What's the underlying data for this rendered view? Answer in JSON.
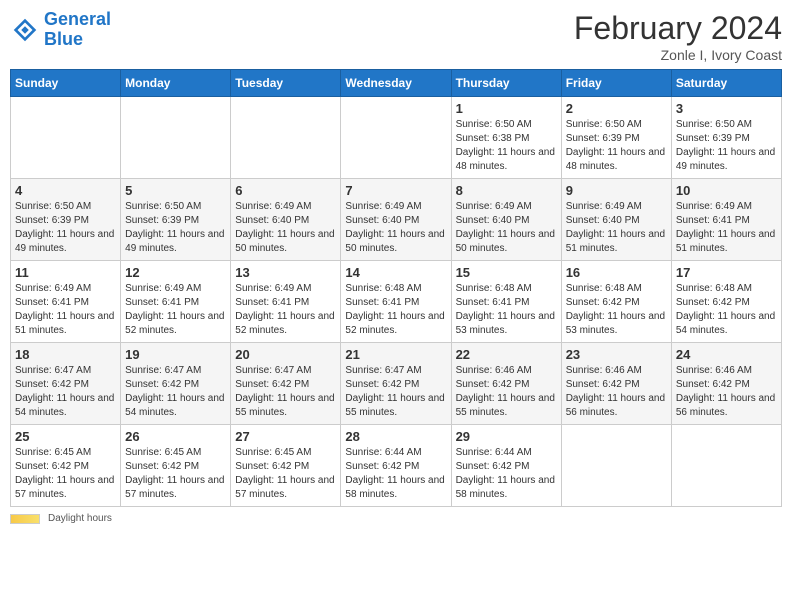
{
  "header": {
    "logo_general": "General",
    "logo_blue": "Blue",
    "month_year": "February 2024",
    "location": "Zonle I, Ivory Coast"
  },
  "days_of_week": [
    "Sunday",
    "Monday",
    "Tuesday",
    "Wednesday",
    "Thursday",
    "Friday",
    "Saturday"
  ],
  "footer": {
    "daylight_label": "Daylight hours"
  },
  "weeks": [
    [
      {
        "day": "",
        "info": ""
      },
      {
        "day": "",
        "info": ""
      },
      {
        "day": "",
        "info": ""
      },
      {
        "day": "",
        "info": ""
      },
      {
        "day": "1",
        "info": "Sunrise: 6:50 AM\nSunset: 6:38 PM\nDaylight: 11 hours\nand 48 minutes."
      },
      {
        "day": "2",
        "info": "Sunrise: 6:50 AM\nSunset: 6:39 PM\nDaylight: 11 hours\nand 48 minutes."
      },
      {
        "day": "3",
        "info": "Sunrise: 6:50 AM\nSunset: 6:39 PM\nDaylight: 11 hours\nand 49 minutes."
      }
    ],
    [
      {
        "day": "4",
        "info": "Sunrise: 6:50 AM\nSunset: 6:39 PM\nDaylight: 11 hours\nand 49 minutes."
      },
      {
        "day": "5",
        "info": "Sunrise: 6:50 AM\nSunset: 6:39 PM\nDaylight: 11 hours\nand 49 minutes."
      },
      {
        "day": "6",
        "info": "Sunrise: 6:49 AM\nSunset: 6:40 PM\nDaylight: 11 hours\nand 50 minutes."
      },
      {
        "day": "7",
        "info": "Sunrise: 6:49 AM\nSunset: 6:40 PM\nDaylight: 11 hours\nand 50 minutes."
      },
      {
        "day": "8",
        "info": "Sunrise: 6:49 AM\nSunset: 6:40 PM\nDaylight: 11 hours\nand 50 minutes."
      },
      {
        "day": "9",
        "info": "Sunrise: 6:49 AM\nSunset: 6:40 PM\nDaylight: 11 hours\nand 51 minutes."
      },
      {
        "day": "10",
        "info": "Sunrise: 6:49 AM\nSunset: 6:41 PM\nDaylight: 11 hours\nand 51 minutes."
      }
    ],
    [
      {
        "day": "11",
        "info": "Sunrise: 6:49 AM\nSunset: 6:41 PM\nDaylight: 11 hours\nand 51 minutes."
      },
      {
        "day": "12",
        "info": "Sunrise: 6:49 AM\nSunset: 6:41 PM\nDaylight: 11 hours\nand 52 minutes."
      },
      {
        "day": "13",
        "info": "Sunrise: 6:49 AM\nSunset: 6:41 PM\nDaylight: 11 hours\nand 52 minutes."
      },
      {
        "day": "14",
        "info": "Sunrise: 6:48 AM\nSunset: 6:41 PM\nDaylight: 11 hours\nand 52 minutes."
      },
      {
        "day": "15",
        "info": "Sunrise: 6:48 AM\nSunset: 6:41 PM\nDaylight: 11 hours\nand 53 minutes."
      },
      {
        "day": "16",
        "info": "Sunrise: 6:48 AM\nSunset: 6:42 PM\nDaylight: 11 hours\nand 53 minutes."
      },
      {
        "day": "17",
        "info": "Sunrise: 6:48 AM\nSunset: 6:42 PM\nDaylight: 11 hours\nand 54 minutes."
      }
    ],
    [
      {
        "day": "18",
        "info": "Sunrise: 6:47 AM\nSunset: 6:42 PM\nDaylight: 11 hours\nand 54 minutes."
      },
      {
        "day": "19",
        "info": "Sunrise: 6:47 AM\nSunset: 6:42 PM\nDaylight: 11 hours\nand 54 minutes."
      },
      {
        "day": "20",
        "info": "Sunrise: 6:47 AM\nSunset: 6:42 PM\nDaylight: 11 hours\nand 55 minutes."
      },
      {
        "day": "21",
        "info": "Sunrise: 6:47 AM\nSunset: 6:42 PM\nDaylight: 11 hours\nand 55 minutes."
      },
      {
        "day": "22",
        "info": "Sunrise: 6:46 AM\nSunset: 6:42 PM\nDaylight: 11 hours\nand 55 minutes."
      },
      {
        "day": "23",
        "info": "Sunrise: 6:46 AM\nSunset: 6:42 PM\nDaylight: 11 hours\nand 56 minutes."
      },
      {
        "day": "24",
        "info": "Sunrise: 6:46 AM\nSunset: 6:42 PM\nDaylight: 11 hours\nand 56 minutes."
      }
    ],
    [
      {
        "day": "25",
        "info": "Sunrise: 6:45 AM\nSunset: 6:42 PM\nDaylight: 11 hours\nand 57 minutes."
      },
      {
        "day": "26",
        "info": "Sunrise: 6:45 AM\nSunset: 6:42 PM\nDaylight: 11 hours\nand 57 minutes."
      },
      {
        "day": "27",
        "info": "Sunrise: 6:45 AM\nSunset: 6:42 PM\nDaylight: 11 hours\nand 57 minutes."
      },
      {
        "day": "28",
        "info": "Sunrise: 6:44 AM\nSunset: 6:42 PM\nDaylight: 11 hours\nand 58 minutes."
      },
      {
        "day": "29",
        "info": "Sunrise: 6:44 AM\nSunset: 6:42 PM\nDaylight: 11 hours\nand 58 minutes."
      },
      {
        "day": "",
        "info": ""
      },
      {
        "day": "",
        "info": ""
      }
    ]
  ]
}
